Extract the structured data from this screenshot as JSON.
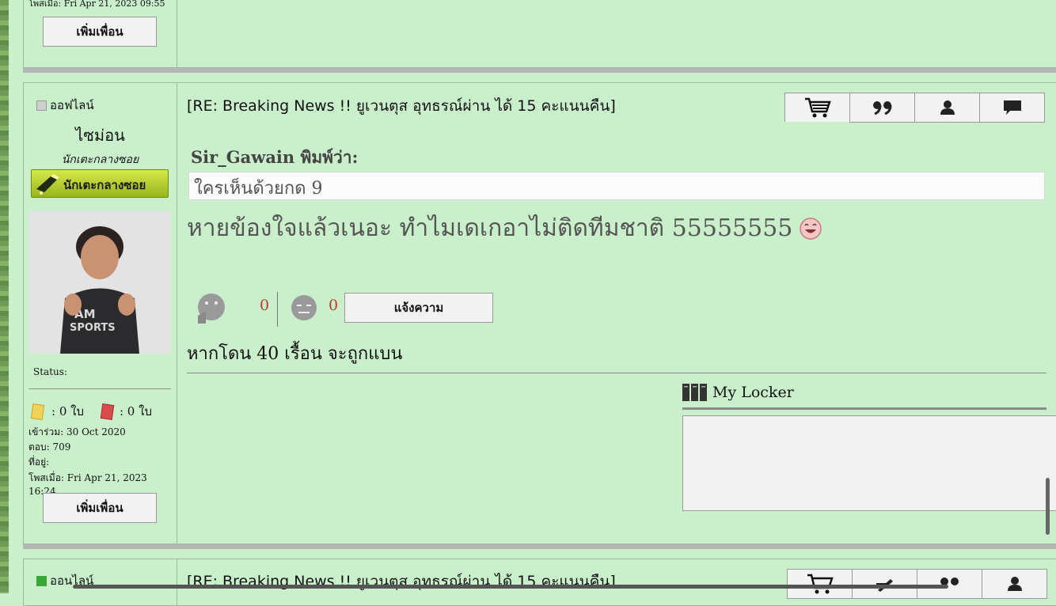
{
  "top_post": {
    "posted_label": "โพสเมื่อ: Fri Apr 21, 2023 09:55",
    "add_friend_label": "เพิ่มเพื่อน"
  },
  "main_post": {
    "user": {
      "status_label": "ออฟไลน์",
      "username": "ไซม่อน",
      "rank": "นักเตะกลางซอย",
      "rank_badge_text": "นักเตะกลางซอย",
      "status_label2": "Status:",
      "yellow_cards": ": 0 ใบ",
      "red_cards": ": 0 ใบ",
      "joined": "เข้าร่วม: 30 Oct 2020",
      "replies": "ตอบ: 709",
      "location": "ที่อยู่:",
      "posted": "โพสเมื่อ: Fri Apr 21, 2023 16:24",
      "add_friend_label": "เพิ่มเพื่อน"
    },
    "title": "[RE: Breaking News !! ยูเวนตุส อุทธรณ์ผ่าน ได้ 15 คะแนนคืน]",
    "quote_author": "Sir_Gawain พิมพ์ว่า:",
    "quote_text": "ใครเห็นด้วยกด 9",
    "body_text": "หายข้องใจแล้วเนอะ ทำไมเดเกอาไม่ติดทีมชาติ 55555555",
    "like_count": "0",
    "dislike_count": "0",
    "report_label": "แจ้งความ",
    "ban_notice": "หากโดน 40 เรื้อน จะถูกแบน",
    "locker_title": "My Locker"
  },
  "next_post": {
    "status_label": "ออนไลน์",
    "title": "[RE: Breaking News !! ยูเวนตุส อุทธรณ์ผ่าน ได้ 15 คะแนนคืน]"
  },
  "colors": {
    "background": "#c9f0cb",
    "count_red": "#c0392b",
    "online_green": "#3aa63a"
  }
}
